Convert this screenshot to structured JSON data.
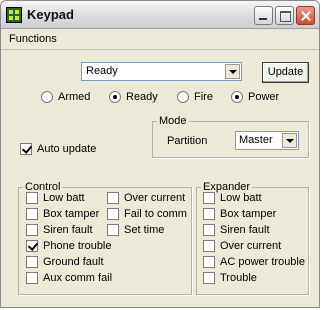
{
  "window": {
    "title": "Keypad"
  },
  "menu": {
    "items": [
      "Functions"
    ]
  },
  "status": {
    "selected": "Ready"
  },
  "update_button": {
    "label": "Update"
  },
  "states": [
    {
      "label": "Armed",
      "checked": false
    },
    {
      "label": "Ready",
      "checked": true
    },
    {
      "label": "Fire",
      "checked": false
    },
    {
      "label": "Power",
      "checked": true
    }
  ],
  "auto_update": {
    "label": "Auto update",
    "checked": true
  },
  "mode": {
    "legend": "Mode",
    "partition_label": "Partition",
    "partition_value": "Master"
  },
  "control": {
    "legend": "Control",
    "col1": [
      {
        "label": "Low batt",
        "checked": false
      },
      {
        "label": "Box tamper",
        "checked": false
      },
      {
        "label": "Siren fault",
        "checked": false
      },
      {
        "label": "Phone trouble",
        "checked": true
      },
      {
        "label": "Ground fault",
        "checked": false
      },
      {
        "label": "Aux comm fail",
        "checked": false
      }
    ],
    "col2": [
      {
        "label": "Over current",
        "checked": false
      },
      {
        "label": "Fail to comm",
        "checked": false
      },
      {
        "label": "Set time",
        "checked": false
      }
    ]
  },
  "expander": {
    "legend": "Expander",
    "items": [
      {
        "label": "Low batt",
        "checked": false
      },
      {
        "label": "Box tamper",
        "checked": false
      },
      {
        "label": "Siren fault",
        "checked": false
      },
      {
        "label": "Over current",
        "checked": false
      },
      {
        "label": "AC power trouble",
        "checked": false
      },
      {
        "label": "Trouble",
        "checked": false
      }
    ]
  }
}
